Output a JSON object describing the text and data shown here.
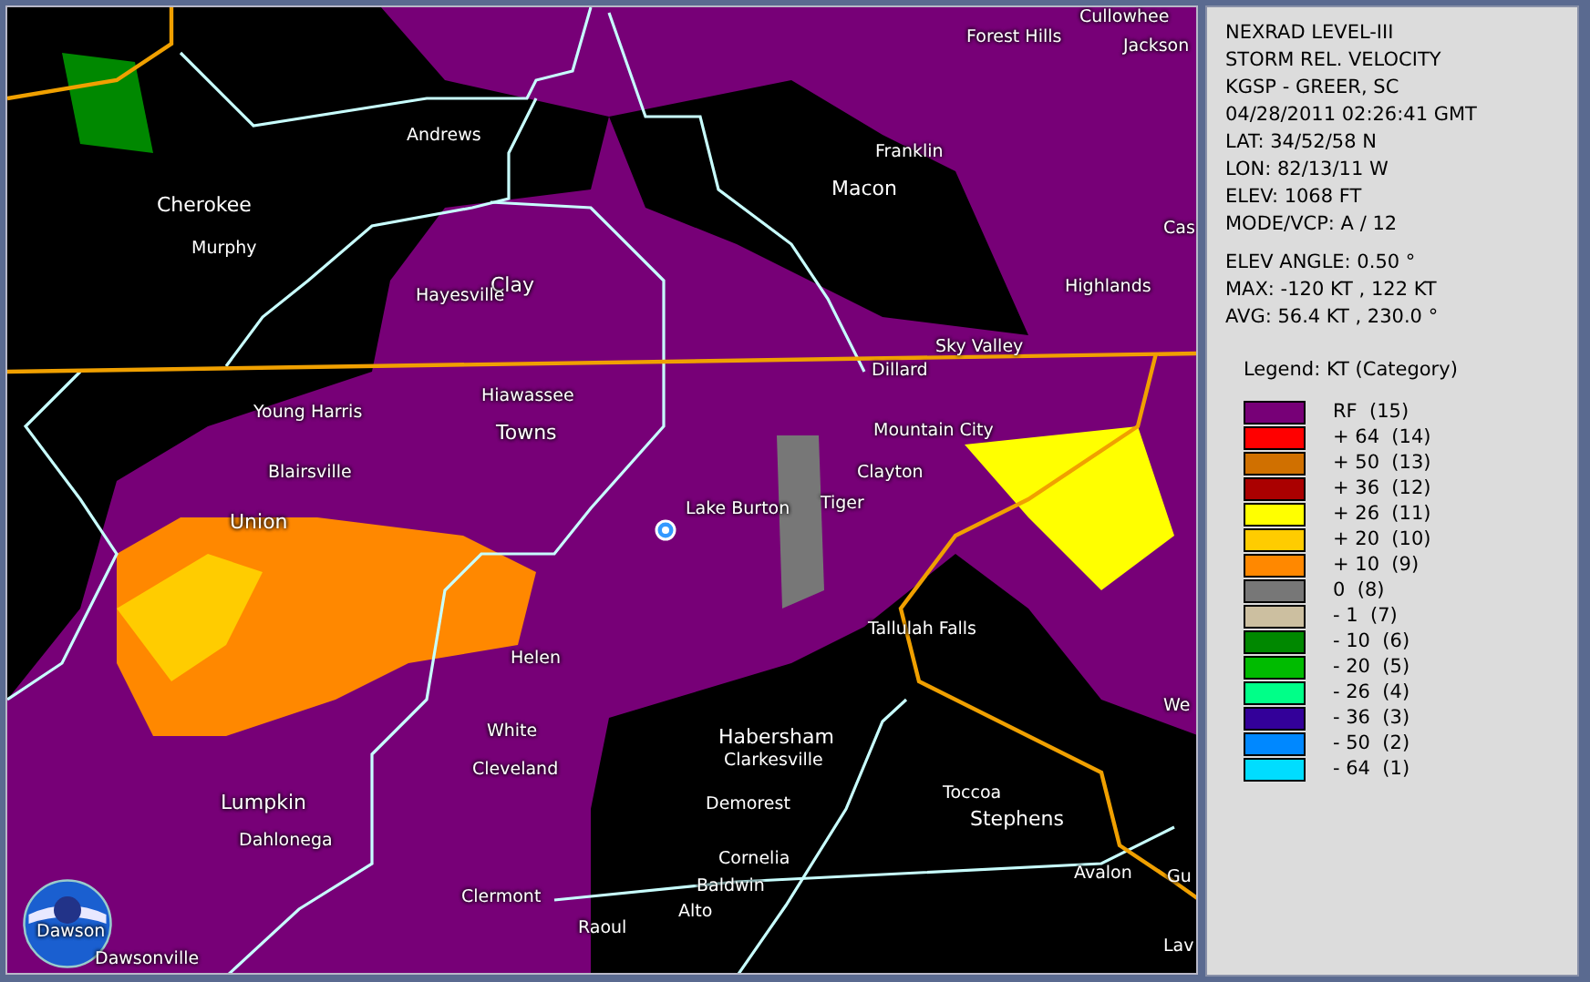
{
  "map": {
    "labels": [
      "Cullowhee",
      "Forest Hills",
      "Jackson",
      "Andrews",
      "Cherokee",
      "Franklin",
      "Macon",
      "Murphy",
      "Cas",
      "Clay",
      "Hayesville",
      "Highlands",
      "Sky Valley",
      "Dillard",
      "Hiawassee",
      "Young Harris",
      "Towns",
      "Mountain City",
      "Blairsville",
      "Clayton",
      "Lake Burton",
      "Tiger",
      "Union",
      "Tallulah Falls",
      "Helen",
      "We",
      "White",
      "Habersham",
      "Clarkesville",
      "Cleveland",
      "Toccoa",
      "Lumpkin",
      "Demorest",
      "Stephens",
      "Dahlonega",
      "Cornelia",
      "Avalon",
      "Gu",
      "Baldwin",
      "Clermont",
      "Alto",
      "Raoul",
      "Dawson",
      "Lav",
      "Dawsonville"
    ]
  },
  "info": {
    "lines": [
      "NEXRAD LEVEL-III",
      "STORM REL. VELOCITY",
      "KGSP - GREER, SC",
      "04/28/2011 02:26:41 GMT",
      "LAT: 34/52/58 N",
      "LON: 82/13/11 W",
      "ELEV: 1068 FT",
      "MODE/VCP: A / 12"
    ],
    "stats": [
      "ELEV ANGLE: 0.50 °",
      "MAX: -120 KT , 122 KT",
      "AVG: 56.4 KT , 230.0 °"
    ]
  },
  "legend": {
    "title": "Legend: KT (Category)",
    "entries": [
      {
        "label": "RF  (15)",
        "color": "#770077"
      },
      {
        "label": "+ 64  (14)",
        "color": "#ff0000"
      },
      {
        "label": "+ 50  (13)",
        "color": "#d07000"
      },
      {
        "label": "+ 36  (12)",
        "color": "#aa0000"
      },
      {
        "label": "+ 26  (11)",
        "color": "#ffff00"
      },
      {
        "label": "+ 20  (10)",
        "color": "#ffcc00"
      },
      {
        "label": "+ 10  (9)",
        "color": "#ff8800"
      },
      {
        "label": "0  (8)",
        "color": "#777777"
      },
      {
        "label": "- 1  (7)",
        "color": "#ccbfa0"
      },
      {
        "label": "- 10  (6)",
        "color": "#008800"
      },
      {
        "label": "- 20  (5)",
        "color": "#00bb00"
      },
      {
        "label": "- 26  (4)",
        "color": "#00ff88"
      },
      {
        "label": "- 36  (3)",
        "color": "#330099"
      },
      {
        "label": "- 50  (2)",
        "color": "#0088ff"
      },
      {
        "label": "- 64  (1)",
        "color": "#00ddff"
      }
    ]
  }
}
